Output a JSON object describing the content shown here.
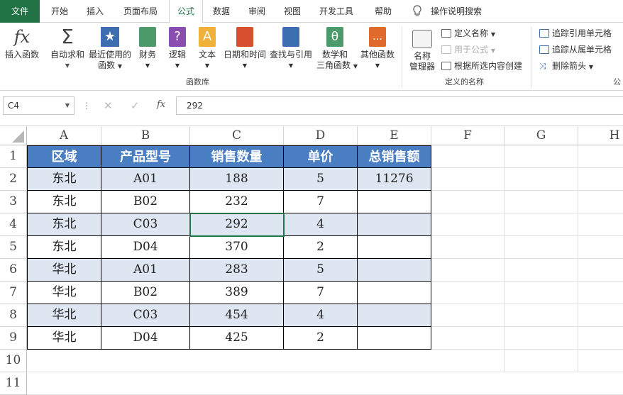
{
  "tabs": [
    "文件",
    "开始",
    "插入",
    "页面布局",
    "公式",
    "数据",
    "审阅",
    "视图",
    "开发工具",
    "帮助",
    "操作说明搜索"
  ],
  "ribbon": {
    "insert_function": "插入函数",
    "autosum": [
      "自动求和"
    ],
    "recent": [
      "最近使用的",
      "函数"
    ],
    "financial": "财务",
    "logical": "逻辑",
    "text": "文本",
    "datetime": "日期和时间",
    "lookup": "查找与引用",
    "math": [
      "数学和",
      "三角函数"
    ],
    "other": "其他函数",
    "group_library": "函数库",
    "name_manager": [
      "名称",
      "管理器"
    ],
    "define_name": "定义名称",
    "use_in_formula": "用于公式",
    "create_from_selection": "根据所选内容创建",
    "group_names": "定义的名称",
    "trace_precedents": "追踪引用单元格",
    "trace_dependents": "追踪从属单元格",
    "remove_arrows": "删除箭头",
    "group_audit_partial": "公"
  },
  "formula_bar": {
    "name_box": "C4",
    "fx": "fx",
    "value": "292"
  },
  "columns": [
    "A",
    "B",
    "C",
    "D",
    "E",
    "F",
    "G",
    "H"
  ],
  "rows": [
    "1",
    "2",
    "3",
    "4",
    "5",
    "6",
    "7",
    "8",
    "9",
    "10",
    "11"
  ],
  "table": {
    "headers": [
      "区域",
      "产品型号",
      "销售数量",
      "单价",
      "总销售额"
    ],
    "rows": [
      [
        "东北",
        "A01",
        "188",
        "5",
        "11276"
      ],
      [
        "东北",
        "B02",
        "232",
        "7",
        ""
      ],
      [
        "东北",
        "C03",
        "292",
        "4",
        ""
      ],
      [
        "东北",
        "D04",
        "370",
        "2",
        ""
      ],
      [
        "华北",
        "A01",
        "283",
        "5",
        ""
      ],
      [
        "华北",
        "B02",
        "389",
        "7",
        ""
      ],
      [
        "华北",
        "C03",
        "454",
        "4",
        ""
      ],
      [
        "华北",
        "D04",
        "425",
        "2",
        ""
      ]
    ]
  },
  "colors": {
    "excel_green": "#217346",
    "header_fill": "#4a7ec2",
    "band_fill": "#dde6f1"
  }
}
